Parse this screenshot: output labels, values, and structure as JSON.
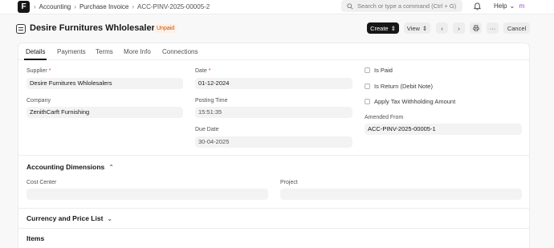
{
  "navbar": {
    "logo_letter": "F",
    "breadcrumbs": [
      "Accounting",
      "Purchase Invoice",
      "ACC-PINV-2025-00005-2"
    ],
    "search_placeholder": "Search or type a command (Ctrl + G)",
    "help_label": "Help",
    "avatar_letter": "m"
  },
  "header": {
    "title": "Desire Furnitures Whlolesalers",
    "status": "Unpaid",
    "create_label": "Create",
    "view_label": "View",
    "cancel_label": "Cancel"
  },
  "tabs": [
    "Details",
    "Payments",
    "Terms",
    "More Info",
    "Connections"
  ],
  "details": {
    "supplier_label": "Supplier",
    "supplier_value": "Desire Furnitures Whlolesalers",
    "company_label": "Company",
    "company_value": "ZenithCarft Furnishing",
    "date_label": "Date",
    "date_value": "01-12-2024",
    "posting_time_label": "Posting Time",
    "posting_time_value": "15:51:35",
    "due_date_label": "Due Date",
    "due_date_value": "30-04-2025",
    "is_paid_label": "Is Paid",
    "is_return_label": "Is Return (Debit Note)",
    "apply_tds_label": "Apply Tax Withholding Amount",
    "amended_from_label": "Amended From",
    "amended_from_value": "ACC-PINV-2025-00005-1"
  },
  "sections": {
    "accounting_dimensions": "Accounting Dimensions",
    "cost_center_label": "Cost Center",
    "project_label": "Project",
    "currency_price_list": "Currency and Price List",
    "items": "Items"
  },
  "colors": {
    "accent": "#171717",
    "status_bg": "#fff0e6",
    "status_text": "#c4530a",
    "required": "#e03636"
  }
}
